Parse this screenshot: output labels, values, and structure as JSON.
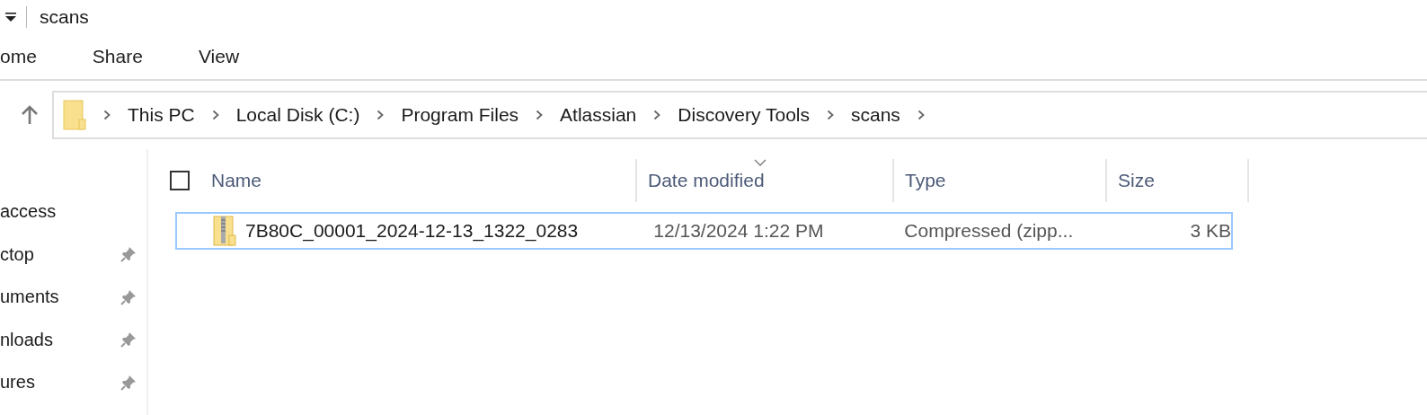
{
  "window": {
    "title": "scans"
  },
  "ribbon_tabs": [
    {
      "label": "ome",
      "selected": false
    },
    {
      "label": "Share",
      "selected": false
    },
    {
      "label": "View",
      "selected": false
    }
  ],
  "address_bar": {
    "path": [
      "This PC",
      "Local Disk (C:)",
      "Program Files",
      "Atlassian",
      "Discovery Tools",
      "scans"
    ]
  },
  "sidebar": {
    "items": [
      {
        "label": "access",
        "pinned": false
      },
      {
        "label": "ctop",
        "pinned": true
      },
      {
        "label": "uments",
        "pinned": true
      },
      {
        "label": "nloads",
        "pinned": true
      },
      {
        "label": "ures",
        "pinned": true
      }
    ]
  },
  "table": {
    "select_all_checked": false,
    "columns": [
      {
        "label": "Name",
        "sorted": false
      },
      {
        "label": "Date modified",
        "sorted": true
      },
      {
        "label": "Type",
        "sorted": false
      },
      {
        "label": "Size",
        "sorted": false
      }
    ],
    "rows": [
      {
        "name": "7B80C_00001_2024-12-13_1322_0283",
        "date_modified": "12/13/2024 1:22 PM",
        "type": "Compressed (zipp...",
        "size": "3 KB",
        "selected": true
      }
    ]
  }
}
